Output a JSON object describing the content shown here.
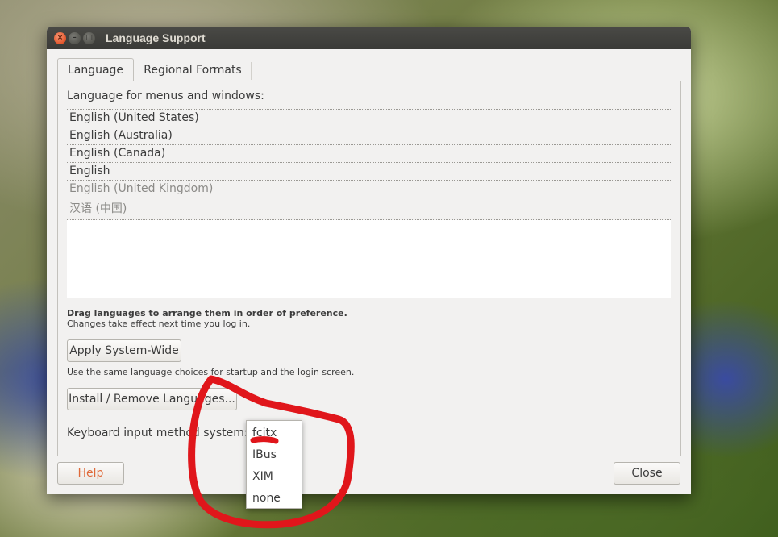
{
  "window": {
    "title": "Language Support",
    "controls": {
      "close": "×",
      "minimize": "–",
      "maximize": "□"
    }
  },
  "tabs": [
    {
      "label": "Language",
      "active": true
    },
    {
      "label": "Regional Formats",
      "active": false
    }
  ],
  "language_tab": {
    "list_label": "Language for menus and windows:",
    "languages": [
      {
        "name": "English (United States)",
        "dim": false
      },
      {
        "name": "English (Australia)",
        "dim": false
      },
      {
        "name": "English (Canada)",
        "dim": false
      },
      {
        "name": "English",
        "dim": false
      },
      {
        "name": "English (United Kingdom)",
        "dim": true
      },
      {
        "name": "汉语 (中国)",
        "dim": true
      }
    ],
    "drag_hint": "Drag languages to arrange them in order of preference.",
    "login_hint": "Changes take effect next time you log in.",
    "apply_button": "Apply System-Wide",
    "apply_hint": "Use the same language choices for startup and the login screen.",
    "install_button": "Install / Remove Languages...",
    "input_method_label": "Keyboard input method system:",
    "input_method_options": [
      "fcitx",
      "IBus",
      "XIM",
      "none"
    ]
  },
  "footer": {
    "help_button": "Help",
    "close_button": "Close"
  },
  "colors": {
    "annotation": "#e0161b",
    "help_text": "#df6a3a",
    "close_control": "#e2552b"
  }
}
